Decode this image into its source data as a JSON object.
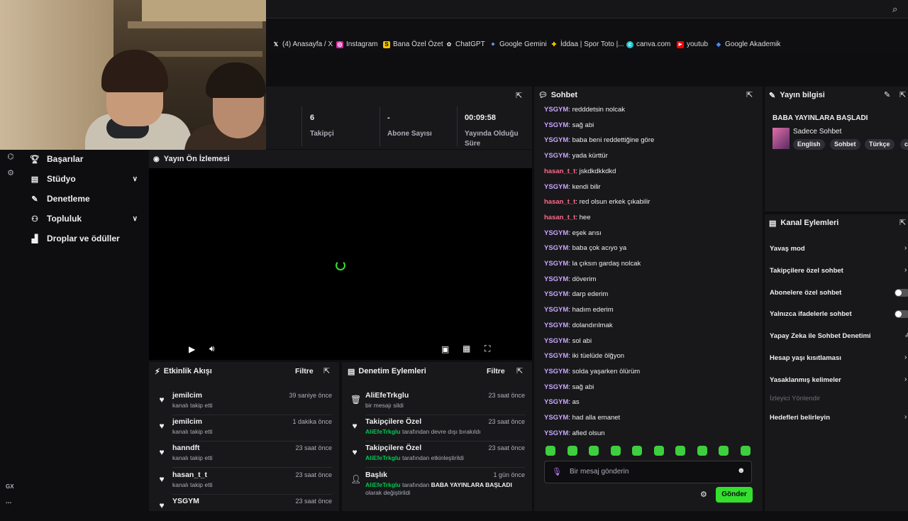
{
  "bookmarks": [
    {
      "label": "(4) Anasayfa / X",
      "icon": "x-icon",
      "color": "#ffffff"
    },
    {
      "label": "Instagram",
      "icon": "instagram-icon",
      "color": "#d6249f"
    },
    {
      "label": "Bana Özel Özet",
      "icon": "s-icon",
      "color": "#f5c400"
    },
    {
      "label": "ChatGPT",
      "icon": "chatgpt-icon",
      "color": "#cfcfcf"
    },
    {
      "label": "Google Gemini",
      "icon": "gemini-icon",
      "color": "#7aa7ff"
    },
    {
      "label": "İddaa | Spor Toto |...",
      "icon": "iddaa-icon",
      "color": "#ffcc00"
    },
    {
      "label": "canva.com",
      "icon": "canva-icon",
      "color": "#20c4cb"
    },
    {
      "label": "youtub",
      "icon": "youtube-icon",
      "color": "#ff0000"
    },
    {
      "label": "Google Akademik",
      "icon": "scholar-icon",
      "color": "#4a8af4"
    }
  ],
  "nav": {
    "items": [
      {
        "label": "Başarılar",
        "icon": "trophy-icon"
      },
      {
        "label": "Stüdyo",
        "icon": "studio-icon",
        "expand": true
      },
      {
        "label": "Denetleme",
        "icon": "wrench-icon"
      },
      {
        "label": "Topluluk",
        "icon": "community-icon",
        "expand": true
      },
      {
        "label": "Droplar ve ödüller",
        "icon": "drops-icon"
      }
    ],
    "gx": "GX",
    "more": "..."
  },
  "stats": [
    {
      "value": "6",
      "label": "Takipçi"
    },
    {
      "value": "-",
      "label": "Abone Sayısı"
    },
    {
      "value": "00:09:58",
      "label": "Yayında Olduğu Süre"
    }
  ],
  "preview": {
    "title": "Yayın Ön İzlemesi"
  },
  "activity": {
    "title": "Etkinlik Akışı",
    "filter": "Filtre",
    "items": [
      {
        "name": "jemilcim",
        "sub": "kanalı takip etti",
        "time": "39 saniye önce"
      },
      {
        "name": "jemilcim",
        "sub": "kanalı takip etti",
        "time": "1 dakika önce"
      },
      {
        "name": "hanndft",
        "sub": "kanalı takip etti",
        "time": "23 saat önce"
      },
      {
        "name": "hasan_t_t",
        "sub": "kanalı takip etti",
        "time": "23 saat önce"
      },
      {
        "name": "YSGYM",
        "sub": "",
        "time": "23 saat önce"
      }
    ]
  },
  "modlog": {
    "title": "Denetim Eylemleri",
    "filter": "Filtre",
    "items": [
      {
        "name": "AliEfeTrkglu",
        "actor": "",
        "sub": "bir mesajı sildi",
        "bold": "",
        "sub2": "",
        "time": "23 saat önce",
        "icon": "trash-icon"
      },
      {
        "name": "Takipçilere Özel",
        "actor": "AliEfeTrkglu",
        "sub": "tarafından devre dışı bırakıldı",
        "bold": "",
        "sub2": "",
        "time": "23 saat önce",
        "icon": "heart-icon"
      },
      {
        "name": "Takipçilere Özel",
        "actor": "AliEfeTrkglu",
        "sub": "tarafından etkinleştirildi",
        "bold": "",
        "sub2": "",
        "time": "23 saat önce",
        "icon": "heart-icon"
      },
      {
        "name": "Başlık",
        "actor": "AliEfeTrkglu",
        "sub": "tarafından",
        "bold": "BABA YAYINLARA BAŞLADI",
        "sub2": "olarak değiştirildi",
        "time": "1 gün önce",
        "icon": "user-edit-icon"
      }
    ]
  },
  "chat": {
    "title": "Sohbet",
    "messages": [
      {
        "user": "YSGYM",
        "text": "redddetsin nolcak"
      },
      {
        "user": "YSGYM",
        "text": "sağ abi"
      },
      {
        "user": "YSGYM",
        "text": "baba beni reddettiğine göre"
      },
      {
        "user": "YSGYM",
        "text": "yada kürttür"
      },
      {
        "user": "hasan_t_t",
        "text": "jskdkdkkdkd"
      },
      {
        "user": "YSGYM",
        "text": "kendi bilir"
      },
      {
        "user": "hasan_t_t",
        "text": "red olsun erkek çıkabilir"
      },
      {
        "user": "hasan_t_t",
        "text": "hee"
      },
      {
        "user": "YSGYM",
        "text": "eşek arısı"
      },
      {
        "user": "YSGYM",
        "text": "baba çok acıyo ya"
      },
      {
        "user": "YSGYM",
        "text": "la çıksın gardaş nolcak"
      },
      {
        "user": "YSGYM",
        "text": "döverim"
      },
      {
        "user": "YSGYM",
        "text": "darp ederim"
      },
      {
        "user": "YSGYM",
        "text": "hadım ederim"
      },
      {
        "user": "YSGYM",
        "text": "dolandırılmak"
      },
      {
        "user": "YSGYM",
        "text": "sol abi"
      },
      {
        "user": "YSGYM",
        "text": "iki tüelüde ölğyon"
      },
      {
        "user": "YSGYM",
        "text": "solda yaşarken ölürüm"
      },
      {
        "user": "YSGYM",
        "text": "sağ abi"
      },
      {
        "user": "YSGYM",
        "text": "as"
      },
      {
        "user": "YSGYM",
        "text": "had alla emanet"
      },
      {
        "user": "YSGYM",
        "text": "afied olsun"
      }
    ],
    "placeholder": "Bir mesaj gönderin",
    "send": "Gönder"
  },
  "info": {
    "title": "Yayın bilgisi",
    "stream_title": "BABA YAYINLARA BAŞLADI",
    "category": "Sadece Sohbet",
    "tags": [
      "English",
      "Sohbet",
      "Türkçe",
      "c"
    ]
  },
  "actions": {
    "title": "Kanal Eylemleri",
    "items": [
      {
        "label": "Yavaş mod",
        "control": "arrow"
      },
      {
        "label": "Takipçilere özel sohbet",
        "control": "arrow"
      },
      {
        "label": "Abonelere özel sohbet",
        "control": "toggle"
      },
      {
        "label": "Yalnızca ifadelerle sohbet",
        "control": "toggle"
      },
      {
        "label": "Yapay Zeka ile Sohbet Denetimi",
        "control": "icon"
      },
      {
        "label": "Hesap yaşı kısıtlaması",
        "control": "arrow"
      },
      {
        "label": "Yasaklanmış kelimeler",
        "control": "arrow"
      },
      {
        "label": "İzleyici Yönlendir",
        "control": "none",
        "dim": true
      },
      {
        "label": "Hedefleri belirleyin",
        "control": "arrow"
      }
    ]
  }
}
